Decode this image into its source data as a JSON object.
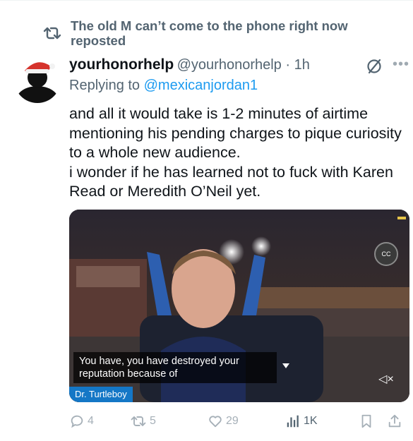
{
  "repost": {
    "text": "The old M can’t come to the phone right now reposted",
    "icon": "repost-icon"
  },
  "author": {
    "display_name": "yourhonorhelp",
    "handle": "@yourhonorhelp",
    "separator": " · ",
    "time": "1h"
  },
  "reply": {
    "prefix": "Replying to ",
    "mention": "@mexicanjordan1"
  },
  "body": {
    "line1": "and all it would take is 1-2 minutes of airtime mentioning his pending charges to pique curiosity to a whole new audience.",
    "line2": "i wonder if he has learned not to fuck with Karen Read or Meredith O’Neil yet."
  },
  "media": {
    "caption": "You have, you have destroyed your reputation because of",
    "channel": "Dr. Turtleboy",
    "cc_label": "CC",
    "mute_label": "◁×"
  },
  "actions": {
    "replies": "4",
    "reposts": "5",
    "likes": "29",
    "views": "1K"
  },
  "colors": {
    "link": "#1d9bf0",
    "muted": "#536471",
    "faint": "#a6b0b8",
    "channel_bg": "#1477c6"
  }
}
